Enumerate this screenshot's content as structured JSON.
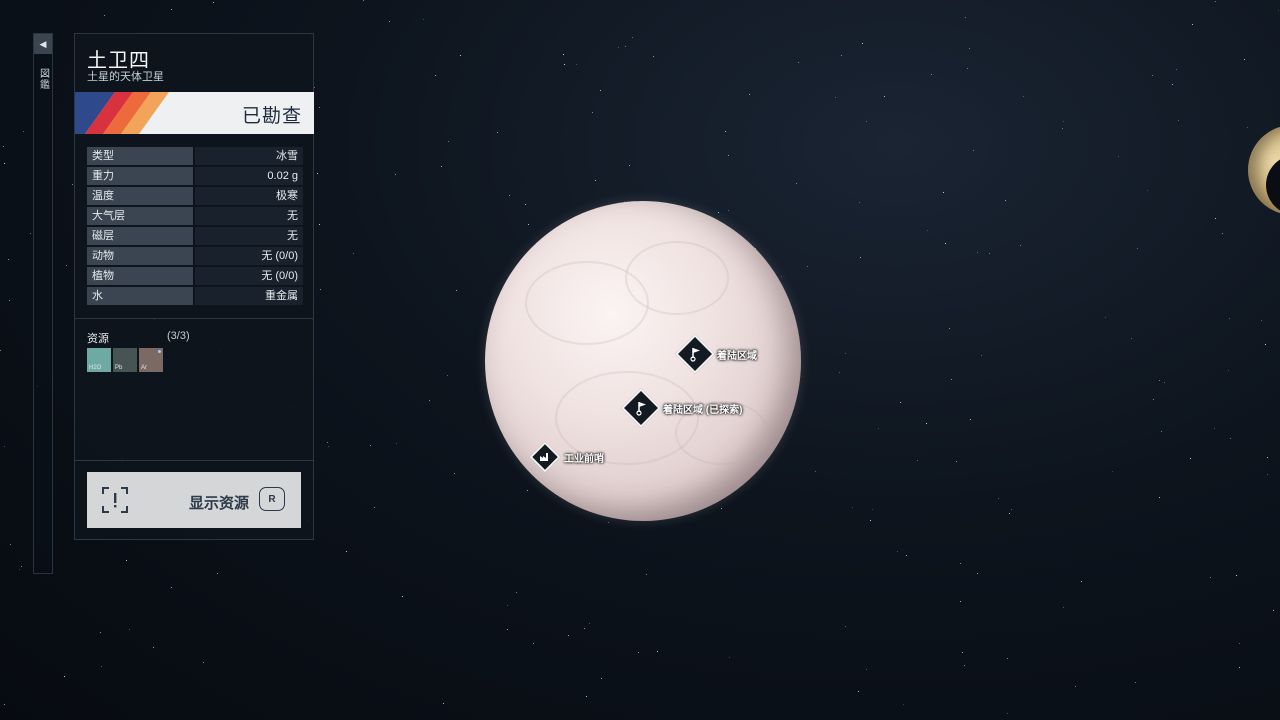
{
  "side_tab": {
    "label": "図鑑"
  },
  "body": {
    "name": "土卫四",
    "subtitle": "土星的天体卫星",
    "survey_status": "已勘查",
    "stats": [
      {
        "key": "类型",
        "value": "冰雪"
      },
      {
        "key": "重力",
        "value": "0.02 g"
      },
      {
        "key": "温度",
        "value": "极寒"
      },
      {
        "key": "大气层",
        "value": "无"
      },
      {
        "key": "磁层",
        "value": "无"
      },
      {
        "key": "动物",
        "value": "无 (0/0)"
      },
      {
        "key": "植物",
        "value": "无 (0/0)"
      },
      {
        "key": "水",
        "value": "重金属"
      }
    ]
  },
  "resources": {
    "label": "资源",
    "count": "(3/3)",
    "items": [
      {
        "code": "H2O",
        "color": "#6fa9a3"
      },
      {
        "code": "Pb",
        "color": "#485354"
      },
      {
        "code": "Ar",
        "color": "#7a6a63"
      }
    ]
  },
  "show_resources": {
    "label": "显示资源",
    "key": "R"
  },
  "markers": [
    {
      "label": "着陆区域"
    },
    {
      "label": "着陆区域 (已探索)"
    },
    {
      "label": "工业前哨"
    }
  ],
  "colors": {
    "stripe1": "#2e4a8c",
    "stripe2": "#d8323e",
    "stripe3": "#ec6a3b",
    "stripe4": "#f2a45a"
  }
}
